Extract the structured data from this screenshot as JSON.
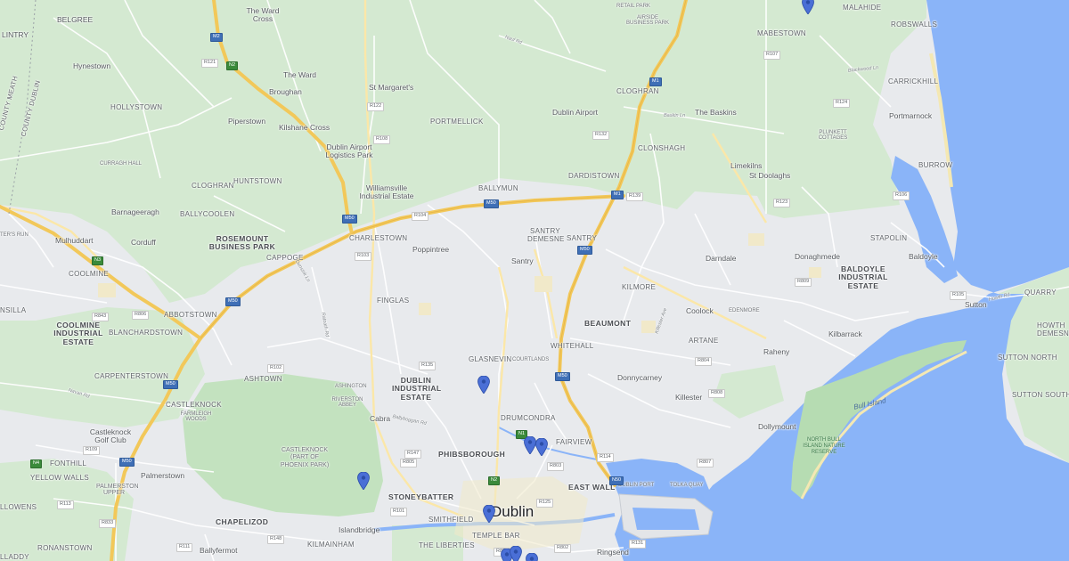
{
  "city_label": "Dublin",
  "water_label": "Bull Island",
  "reserve_label": "NORTH BULL ISLAND NATURE RESERVE",
  "park_labels": {
    "castleknock_park": "CASTLEKNOCK (PART OF PHOENIX PARK)",
    "golf_club": "Castleknock Golf Club",
    "farmleigh": "FARMLEIGH WOODS"
  },
  "county_labels": {
    "meath": "COUNTY MEATH",
    "dublin": "COUNTY DUBLIN"
  },
  "places": {
    "belgree": "BELGREE",
    "lintry": "LINTRY",
    "the_ward_cross": "The Ward Cross",
    "the_ward": "The Ward",
    "hynestown": "Hynestown",
    "hollystown": "HOLLYSTOWN",
    "broughan": "Broughan",
    "st_margarets": "St Margaret's",
    "piperstown": "Piperstown",
    "kilshane_cross": "Kilshane Cross",
    "portmellick": "PORTMELLICK",
    "dublin_airport_logistics": "Dublin Airport Logistics Park",
    "williamsville": "Williamsville Industrial Estate",
    "curragh_hall": "CURRAGH HALL",
    "cloghran_w": "CLOGHRAN",
    "huntstown": "HUNTSTOWN",
    "ballycoolen": "BALLYCOOLEN",
    "barnageeragh": "Barnageeragh",
    "corduff": "Corduff",
    "mulhuddart": "Mulhuddart",
    "ters_run": "TER'S RUN",
    "rosemount": "ROSEMOUNT BUSINESS PARK",
    "cappoge": "CAPPOGE",
    "charlestown": "CHARLESTOWN",
    "poppintree": "Poppintree",
    "ballymun": "BALLYMUN",
    "santry_demesne": "SANTRY DEMESNE",
    "santry_caps": "SANTRY",
    "santry": "Santry",
    "dardistown": "DARDISTOWN",
    "cloghran": "CLOGHRAN",
    "dublin_airport": "Dublin Airport",
    "airside": "AIRSIDE BUSINESS PARK",
    "retail_park": "RETAIL PARK",
    "the_baskins": "The Baskins",
    "clonshagh": "CLONSHAGH",
    "limekilns": "Limekilns",
    "st_doolaghs": "St Doolaghs",
    "malahide": "MALAHIDE",
    "mabestown": "MABESTOWN",
    "robswalls": "ROBSWALLS",
    "carrickhill": "CARRICKHILL",
    "portmarnock": "Portmarnock",
    "plunkett": "PLUNKETT COTTAGES",
    "burrow": "BURROW",
    "stapolin": "STAPOLIN",
    "baldoyle": "Baldoyle",
    "baldoyle_ie": "BALDOYLE INDUSTRIAL ESTATE",
    "donaghmede": "Donaghmede",
    "darndale": "Darndale",
    "kilmore": "KILMORE",
    "coolock": "Coolock",
    "edenmore": "EDENMORE",
    "beaumont": "BEAUMONT",
    "artane": "ARTANE",
    "kilbarrack": "Kilbarrack",
    "raheny": "Raheny",
    "donnycarney": "Donnycarney",
    "killester": "Killester",
    "dollymount": "Dollymount",
    "whitehall": "WHITEHALL",
    "glasnevin": "GLASNEVIN",
    "courtlands": "COURTLANDS",
    "finglas": "FINGLAS",
    "coolmine": "COOLMINE",
    "coolmine_ie": "COOLMINE INDUSTRIAL ESTATE",
    "abbotstown": "ABBOTSTOWN",
    "blanchardstown": "BLANCHARDSTOWN",
    "nsilla": "NSILLA",
    "carpenterstown": "CARPENTERSTOWN",
    "ashtown": "ASHTOWN",
    "ashington": "ASHINGTON",
    "riverston": "RIVERSTON ABBEY",
    "dublin_ie": "DUBLIN INDUSTRIAL ESTATE",
    "cabra": "Cabra",
    "drumcondra": "DRUMCONDRA",
    "fairview": "FAIRVIEW",
    "castleknock": "CASTLEKNOCK",
    "phibsborough": "PHIBSBOROUGH",
    "east_wall": "EAST WALL",
    "dublin_port": "DUBLIN PORT",
    "tolka_quay": "TOLKA QUAY",
    "stoneybatter": "STONEYBATTER",
    "smithfield": "SMITHFIELD",
    "temple_bar": "TEMPLE BAR",
    "the_liberties": "THE LIBERTIES",
    "kilmainham": "KILMAINHAM",
    "islandbridge": "Islandbridge",
    "chapelizod": "CHAPELIZOD",
    "ballyfermot": "Ballyfermot",
    "ringsend": "Ringsend",
    "fonthill": "FONTHILL",
    "yellow_walls": "YELLOW WALLS",
    "palmerstown": "Palmerstown",
    "palmerston_upper": "PALMERSTON UPPER",
    "llowens": "LLOWENS",
    "ronanstown": "RONANSTOWN",
    "lladdy": "LLADDY",
    "sutton": "Sutton",
    "quarry": "QUARRY",
    "sutton_north": "SUTTON NORTH",
    "sutton_south": "SUTTON SOUTH",
    "howth_demesne": "HOWTH DEMESNE"
  },
  "road_names": {
    "nutgrove_rd": "Naul Rd",
    "malahide_rd": "Malahide Rd",
    "baskin_ln": "Baskin Ln",
    "blackwood_ln": "Blackwood Ln",
    "howth_rd": "Howth Rd",
    "ballyboggan": "Ballyboggan Rd",
    "navan_rd": "Navan Rd",
    "tolka": "Tolka",
    "killester_ave": "Killester Ave",
    "ratoath_rd": "Ratoath Rd",
    "dunsink": "Dunsink Ln"
  },
  "road_shields": [
    {
      "id": "m2",
      "text": "M2",
      "kind": "mot"
    },
    {
      "id": "n2",
      "text": "N2",
      "kind": "nat"
    },
    {
      "id": "m1a",
      "text": "M1",
      "kind": "mot"
    },
    {
      "id": "m1b",
      "text": "M1",
      "kind": "mot"
    },
    {
      "id": "m50a",
      "text": "M50",
      "kind": "mot"
    },
    {
      "id": "m50b",
      "text": "M50",
      "kind": "mot"
    },
    {
      "id": "m50c",
      "text": "M50",
      "kind": "mot"
    },
    {
      "id": "m50d",
      "text": "M50",
      "kind": "mot"
    },
    {
      "id": "m50e",
      "text": "M50",
      "kind": "mot"
    },
    {
      "id": "m50f",
      "text": "M50",
      "kind": "mot"
    },
    {
      "id": "n3",
      "text": "N3",
      "kind": "nat"
    },
    {
      "id": "n4",
      "text": "N4",
      "kind": "nat"
    },
    {
      "id": "n1",
      "text": "N1",
      "kind": "nat"
    },
    {
      "id": "n2b",
      "text": "N2",
      "kind": "nat"
    },
    {
      "id": "m50g",
      "text": "M50",
      "kind": "mot"
    },
    {
      "id": "n50",
      "text": "N50",
      "kind": "mot"
    },
    {
      "id": "r121",
      "text": "R121",
      "kind": "reg"
    },
    {
      "id": "r122",
      "text": "R122",
      "kind": "reg"
    },
    {
      "id": "r108",
      "text": "R108",
      "kind": "reg"
    },
    {
      "id": "r132",
      "text": "R132",
      "kind": "reg"
    },
    {
      "id": "r139",
      "text": "R139",
      "kind": "reg"
    },
    {
      "id": "r104",
      "text": "R104",
      "kind": "reg"
    },
    {
      "id": "r103",
      "text": "R103",
      "kind": "reg"
    },
    {
      "id": "r135",
      "text": "R135",
      "kind": "reg"
    },
    {
      "id": "r107",
      "text": "R107",
      "kind": "reg"
    },
    {
      "id": "r124",
      "text": "R124",
      "kind": "reg"
    },
    {
      "id": "r123",
      "text": "R123",
      "kind": "reg"
    },
    {
      "id": "r106",
      "text": "R106",
      "kind": "reg"
    },
    {
      "id": "r105",
      "text": "R105",
      "kind": "reg"
    },
    {
      "id": "r809",
      "text": "R809",
      "kind": "reg"
    },
    {
      "id": "r843",
      "text": "R843",
      "kind": "reg"
    },
    {
      "id": "r806",
      "text": "R806",
      "kind": "reg"
    },
    {
      "id": "r102",
      "text": "R102",
      "kind": "reg"
    },
    {
      "id": "r147",
      "text": "R147",
      "kind": "reg"
    },
    {
      "id": "r805",
      "text": "R805",
      "kind": "reg"
    },
    {
      "id": "r101",
      "text": "R101",
      "kind": "reg"
    },
    {
      "id": "r109",
      "text": "R109",
      "kind": "reg"
    },
    {
      "id": "r833",
      "text": "R833",
      "kind": "reg"
    },
    {
      "id": "r148",
      "text": "R148",
      "kind": "reg"
    },
    {
      "id": "r111",
      "text": "R111",
      "kind": "reg"
    },
    {
      "id": "r131",
      "text": "R131",
      "kind": "reg"
    },
    {
      "id": "r802",
      "text": "R802",
      "kind": "reg"
    },
    {
      "id": "r803",
      "text": "R803",
      "kind": "reg"
    },
    {
      "id": "r804",
      "text": "R804",
      "kind": "reg"
    },
    {
      "id": "r808",
      "text": "R808",
      "kind": "reg"
    },
    {
      "id": "r835",
      "text": "R835",
      "kind": "reg"
    },
    {
      "id": "r807",
      "text": "R807",
      "kind": "reg"
    },
    {
      "id": "r125",
      "text": "R125",
      "kind": "reg"
    },
    {
      "id": "r113",
      "text": "R113",
      "kind": "reg"
    },
    {
      "id": "r114",
      "text": "R114",
      "kind": "reg"
    }
  ],
  "pins": [
    {
      "id": "pin-malahide"
    },
    {
      "id": "pin-glasnevin"
    },
    {
      "id": "pin-drumcondra-1"
    },
    {
      "id": "pin-drumcondra-2"
    },
    {
      "id": "pin-phoenix-park"
    },
    {
      "id": "pin-city-centre"
    },
    {
      "id": "pin-south-1"
    },
    {
      "id": "pin-south-2"
    },
    {
      "id": "pin-south-3"
    }
  ],
  "colors": {
    "land": "#e8eaed",
    "green": "#cfe6cd",
    "sea": "#8ab4f8",
    "motorway": "#f2d27a",
    "pin": "#4a6fd6",
    "park": "#b6dcb2"
  }
}
